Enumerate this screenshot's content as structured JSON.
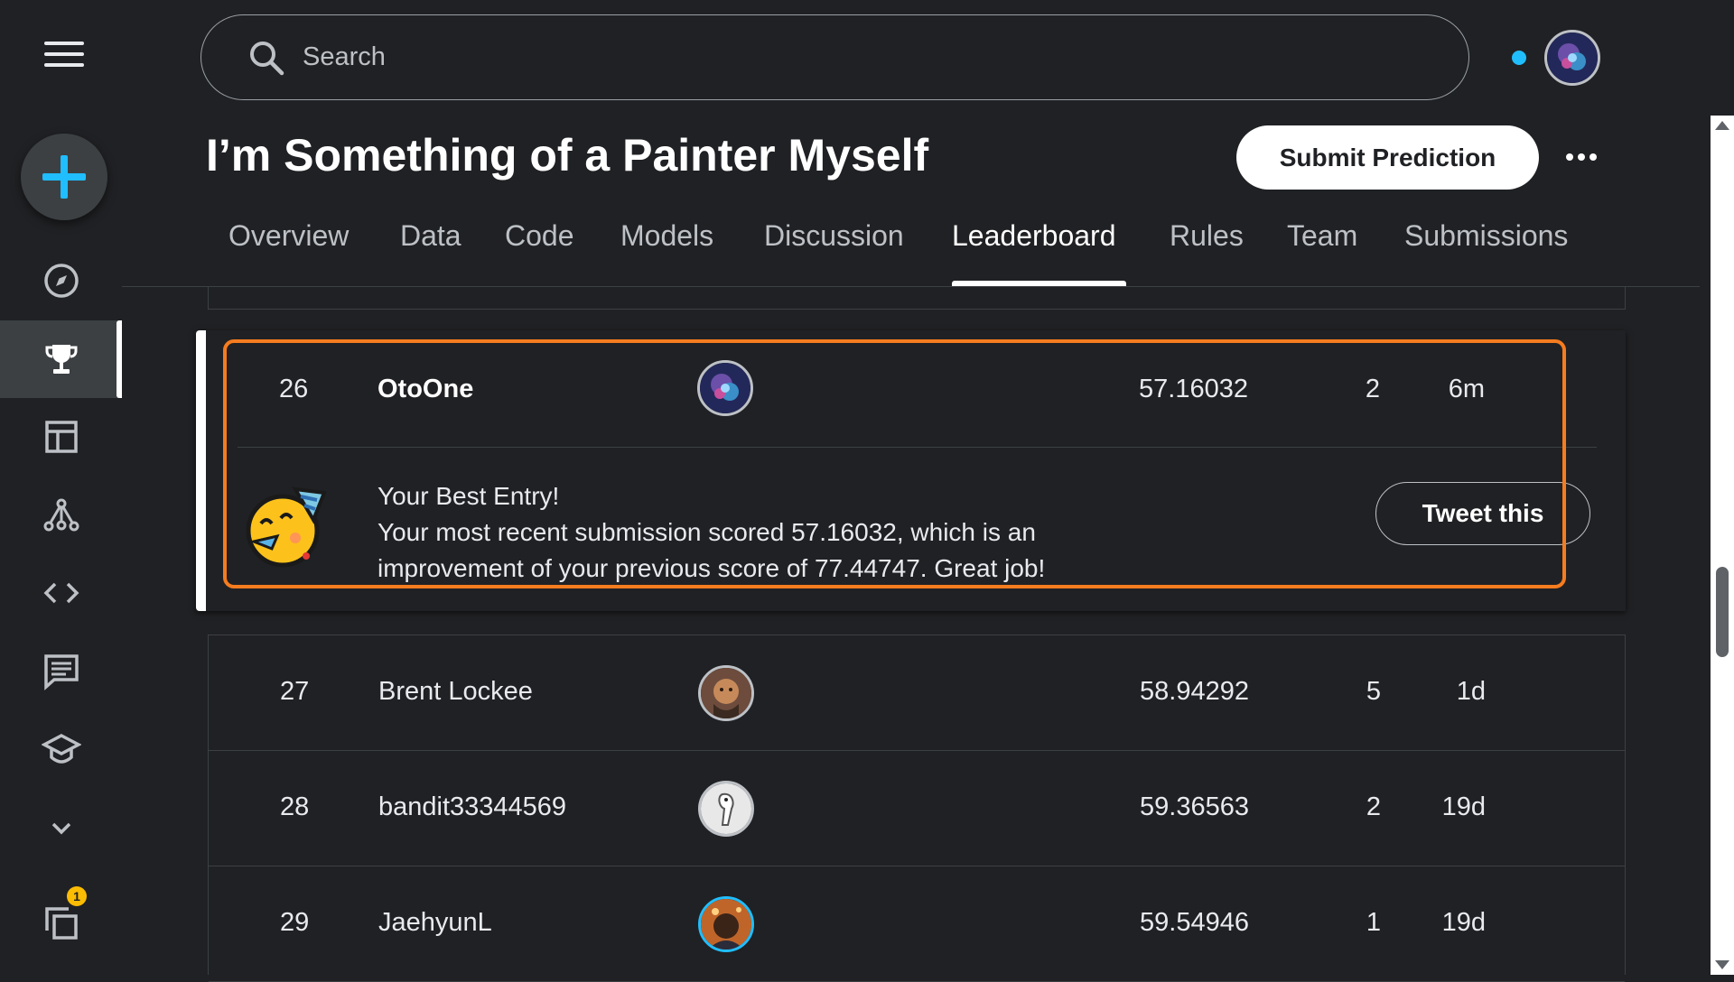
{
  "search": {
    "placeholder": "Search"
  },
  "page": {
    "title": "I’m Something of a Painter Myself"
  },
  "header": {
    "submit_label": "Submit Prediction"
  },
  "tabs": [
    {
      "label": "Overview"
    },
    {
      "label": "Data"
    },
    {
      "label": "Code"
    },
    {
      "label": "Models"
    },
    {
      "label": "Discussion"
    },
    {
      "label": "Leaderboard",
      "active": true
    },
    {
      "label": "Rules"
    },
    {
      "label": "Team"
    },
    {
      "label": "Submissions"
    }
  ],
  "sidebar": {
    "items": [
      {
        "icon": "compass-icon"
      },
      {
        "icon": "trophy-icon",
        "active": true
      },
      {
        "icon": "table-icon"
      },
      {
        "icon": "models-icon"
      },
      {
        "icon": "code-icon"
      },
      {
        "icon": "discussion-icon"
      },
      {
        "icon": "school-icon"
      },
      {
        "icon": "chevron-down-icon"
      },
      {
        "icon": "stacked-copies-icon"
      }
    ],
    "badge_count": "1",
    "accent_color": "#20beff"
  },
  "best_entry": {
    "rank": "26",
    "team": "OtoOne",
    "score": "57.16032",
    "entries": "2",
    "last": "6m",
    "title": "Your Best Entry!",
    "line1": "Your most recent submission scored 57.16032, which is an",
    "line2": "improvement of your previous score of 77.44747. Great job!",
    "tweet_label": "Tweet this",
    "highlight_color": "#f57c1f"
  },
  "rows": [
    {
      "rank": "27",
      "team": "Brent Lockee",
      "score": "58.94292",
      "entries": "5",
      "last": "1d"
    },
    {
      "rank": "28",
      "team": "bandit33344569",
      "score": "59.36563",
      "entries": "2",
      "last": "19d"
    },
    {
      "rank": "29",
      "team": "JaehyunL",
      "score": "59.54946",
      "entries": "1",
      "last": "19d"
    }
  ]
}
